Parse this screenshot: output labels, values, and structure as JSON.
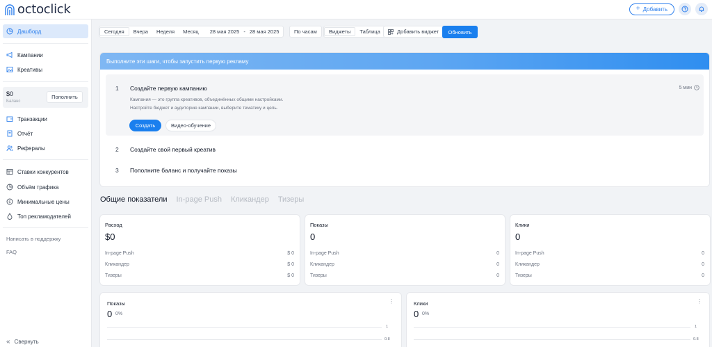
{
  "brand": {
    "name": "octoclick"
  },
  "header": {
    "add_label": "Добавить",
    "help_icon": "question-circle-icon",
    "bell_icon": "bell-icon"
  },
  "sidebar": {
    "dashboard": "Дашборд",
    "campaigns": "Кампании",
    "creatives": "Креативы",
    "balance_amount": "$0",
    "balance_label": "Баланс",
    "topup": "Пополнить",
    "transactions": "Транзакции",
    "report": "Отчёт",
    "referrals": "Рефералы",
    "competitor_bids": "Ставки конкурентов",
    "traffic_volume": "Объём трафика",
    "min_prices": "Минимальные цены",
    "top_advertisers": "Топ рекламодателей",
    "support": "Написать в поддержку",
    "faq": "FAQ",
    "collapse": "Свернуть"
  },
  "toolbar": {
    "periods": [
      "Сегодня",
      "Вчера",
      "Неделя",
      "Месяц"
    ],
    "selected_period": "Сегодня",
    "date_from": "28 мая 2025",
    "date_separator": "-",
    "date_to": "28 мая 2025",
    "group_by": "По часам",
    "views": [
      "Виджеты",
      "Таблица"
    ],
    "selected_view": "Виджеты",
    "add_widget": "Добавить виджет",
    "update": "Обновить"
  },
  "onboarding": {
    "header": "Выполните эти шаги, чтобы запустить первую рекламу",
    "steps": [
      {
        "num": "1",
        "title": "Создайте первую кампанию",
        "time": "5 мин",
        "desc_line1": "Кампания — это группа креативов, объединённых общими настройками.",
        "desc_line2": "Настройте бюджет и аудиторию кампании, выберите тематику и цель.",
        "primary": "Создать",
        "secondary": "Видео-обучение"
      },
      {
        "num": "2",
        "title": "Создайте свой первый креатив"
      },
      {
        "num": "3",
        "title": "Пополните баланс и получайте показы"
      }
    ]
  },
  "stats_tabs": [
    "Общие показатели",
    "In-page Push",
    "Кликандер",
    "Тизеры"
  ],
  "stats_cards": [
    {
      "title": "Расход",
      "value": "$0",
      "rows": [
        {
          "label": "In-page Push",
          "value": "$ 0"
        },
        {
          "label": "Кликандер",
          "value": "$ 0"
        },
        {
          "label": "Тизеры",
          "value": "$ 0"
        }
      ]
    },
    {
      "title": "Показы",
      "value": "0",
      "rows": [
        {
          "label": "In-page Push",
          "value": "0"
        },
        {
          "label": "Кликандер",
          "value": "0"
        },
        {
          "label": "Тизеры",
          "value": "0"
        }
      ]
    },
    {
      "title": "Клики",
      "value": "0",
      "rows": [
        {
          "label": "In-page Push",
          "value": "0"
        },
        {
          "label": "Кликандер",
          "value": "0"
        },
        {
          "label": "Тизеры",
          "value": "0"
        }
      ]
    }
  ],
  "chart_cards": [
    {
      "title": "Показы",
      "value": "0",
      "change": "0%",
      "ticks": [
        "1",
        "0.8"
      ]
    },
    {
      "title": "Клики",
      "value": "0",
      "change": "0%",
      "ticks": [
        "1",
        "0.8"
      ]
    }
  ],
  "colors": {
    "accent": "#1a7fee",
    "active_bg": "#dce9fb",
    "page_bg": "#f1f3f6"
  }
}
